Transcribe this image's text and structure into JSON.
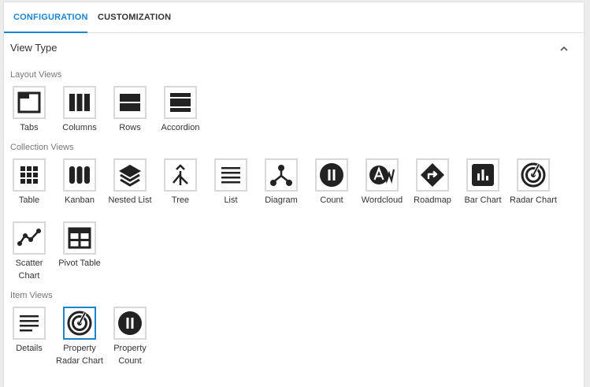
{
  "tabs": [
    {
      "label": "CONFIGURATION",
      "active": true
    },
    {
      "label": "CUSTOMIZATION",
      "active": false
    }
  ],
  "section": {
    "title": "View Type",
    "collapse_icon": "chevron-up-icon"
  },
  "groups": {
    "layout": {
      "label": "Layout Views",
      "items": [
        {
          "label": "Tabs",
          "icon": "tabs-icon"
        },
        {
          "label": "Columns",
          "icon": "columns-icon"
        },
        {
          "label": "Rows",
          "icon": "rows-icon"
        },
        {
          "label": "Accordion",
          "icon": "accordion-icon"
        }
      ]
    },
    "collection": {
      "label": "Collection Views",
      "items": [
        {
          "label": "Table",
          "icon": "grid-icon"
        },
        {
          "label": "Kanban",
          "icon": "kanban-icon"
        },
        {
          "label": "Nested List",
          "icon": "layers-icon"
        },
        {
          "label": "Tree",
          "icon": "merge-icon"
        },
        {
          "label": "List",
          "icon": "list-icon"
        },
        {
          "label": "Diagram",
          "icon": "diagram-icon"
        },
        {
          "label": "Count",
          "icon": "pause-circle-icon"
        },
        {
          "label": "Wordcloud",
          "icon": "wordcloud-icon"
        },
        {
          "label": "Roadmap",
          "icon": "roadmap-icon"
        },
        {
          "label": "Bar Chart",
          "icon": "bar-chart-icon"
        },
        {
          "label": "Radar Chart",
          "icon": "radar-icon"
        },
        {
          "label": "Scatter Chart",
          "icon": "scatter-icon"
        },
        {
          "label": "Pivot Table",
          "icon": "pivot-table-icon"
        }
      ]
    },
    "item": {
      "label": "Item Views",
      "items": [
        {
          "label": "Details",
          "icon": "details-icon"
        },
        {
          "label": "Property Radar Chart",
          "icon": "radar-icon",
          "selected": true
        },
        {
          "label": "Property Count",
          "icon": "pause-circle-icon"
        }
      ]
    }
  },
  "colors": {
    "accent": "#1b86d0",
    "icon": "#222222",
    "border": "#d8d8d8"
  }
}
